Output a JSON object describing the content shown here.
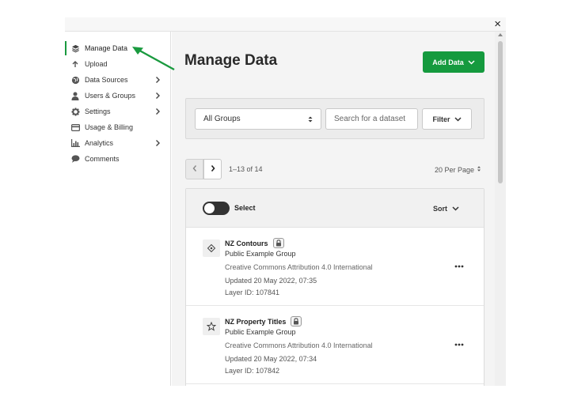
{
  "window": {
    "close_label": "×"
  },
  "sidebar": {
    "items": [
      {
        "label": "Manage Data",
        "icon": "layers-icon",
        "active": true,
        "chevron": false
      },
      {
        "label": "Upload",
        "icon": "upload-arrow-icon",
        "active": false,
        "chevron": false
      },
      {
        "label": "Data Sources",
        "icon": "globe-icon",
        "active": false,
        "chevron": true
      },
      {
        "label": "Users & Groups",
        "icon": "user-icon",
        "active": false,
        "chevron": true
      },
      {
        "label": "Settings",
        "icon": "gear-icon",
        "active": false,
        "chevron": true
      },
      {
        "label": "Usage & Billing",
        "icon": "credit-card-icon",
        "active": false,
        "chevron": false
      },
      {
        "label": "Analytics",
        "icon": "bar-chart-icon",
        "active": false,
        "chevron": true
      },
      {
        "label": "Comments",
        "icon": "speech-bubble-icon",
        "active": false,
        "chevron": false
      }
    ]
  },
  "main": {
    "title": "Manage Data",
    "add_button": "Add Data",
    "filters": {
      "group_select": "All Groups",
      "search_placeholder": "Search for a dataset",
      "filter_button": "Filter"
    },
    "pager": {
      "range": "1–13 of 14",
      "per_page": "20 Per Page"
    },
    "list": {
      "select_label": "Select",
      "sort_label": "Sort",
      "items": [
        {
          "name": "NZ Contours",
          "group": "Public Example Group",
          "license": "Creative Commons Attribution 4.0 International",
          "updated": "Updated 20 May 2022, 07:35",
          "layer_id": "Layer ID: 107841",
          "icon": "line-layer-icon"
        },
        {
          "name": "NZ Property Titles",
          "group": "Public Example Group",
          "license": "Creative Commons Attribution 4.0 International",
          "updated": "Updated 20 May 2022, 07:34",
          "layer_id": "Layer ID: 107842",
          "icon": "polygon-layer-icon"
        }
      ]
    }
  },
  "colors": {
    "accent": "#159a3e",
    "active_indicator": "#1a9a3f",
    "panel_bg": "#f4f4f4"
  }
}
